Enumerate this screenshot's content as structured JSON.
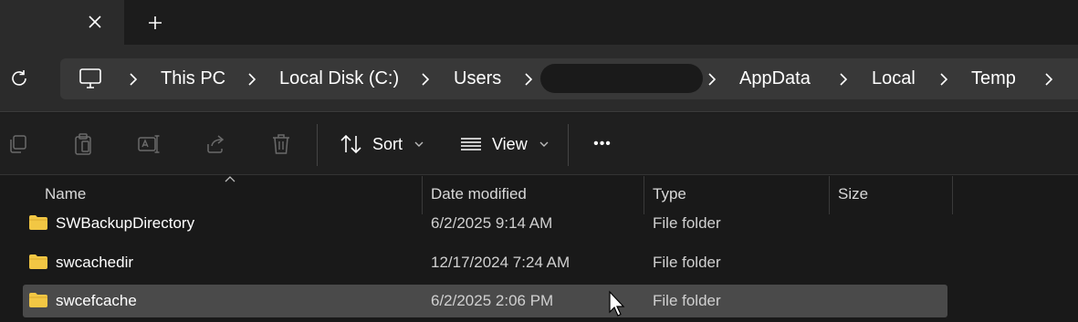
{
  "tabs": {
    "close_icon": "close-icon",
    "new_tab_icon": "plus-icon"
  },
  "nav": {
    "refresh_icon": "refresh-icon",
    "breadcrumb": [
      "This PC",
      "Local Disk (C:)",
      "Users",
      "",
      "AppData",
      "Local",
      "Temp"
    ]
  },
  "commands": {
    "sort_label": "Sort",
    "view_label": "View",
    "more_label": "•••"
  },
  "columns": {
    "name": "Name",
    "date_modified": "Date modified",
    "type": "Type",
    "size": "Size"
  },
  "rows": [
    {
      "name": "SWBackupDirectory",
      "date": "6/2/2025 9:14 AM",
      "type": "File folder",
      "selected": false
    },
    {
      "name": "swcachedir",
      "date": "12/17/2024 7:24 AM",
      "type": "File folder",
      "selected": false
    },
    {
      "name": "swcefcache",
      "date": "6/2/2025 2:06 PM",
      "type": "File folder",
      "selected": true
    }
  ],
  "colors": {
    "folder": "#f2c744",
    "background": "#191919",
    "selected_row": "#4a4a4a"
  }
}
